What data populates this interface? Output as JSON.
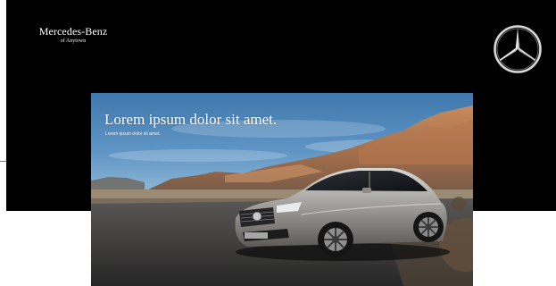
{
  "header": {
    "brand_name": "Mercedes-Benz",
    "brand_location": "of Anytown",
    "logo_icon": "three-pointed-star-icon"
  },
  "hero": {
    "headline": "Lorem ipsum dolor sit amet.",
    "subline": "Lorem ipsum dolor sit amet."
  },
  "colors": {
    "header_background": "#000000",
    "page_background": "#ffffff",
    "text": "#ffffff"
  }
}
